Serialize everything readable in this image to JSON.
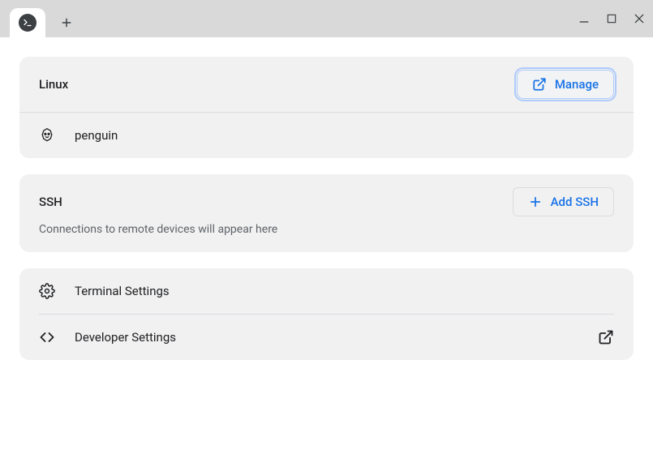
{
  "linux": {
    "title": "Linux",
    "manage_label": "Manage",
    "item_label": "penguin"
  },
  "ssh": {
    "title": "SSH",
    "add_label": "Add SSH",
    "empty_text": "Connections to remote devices will appear here"
  },
  "settings": {
    "terminal_label": "Terminal Settings",
    "developer_label": "Developer Settings"
  }
}
